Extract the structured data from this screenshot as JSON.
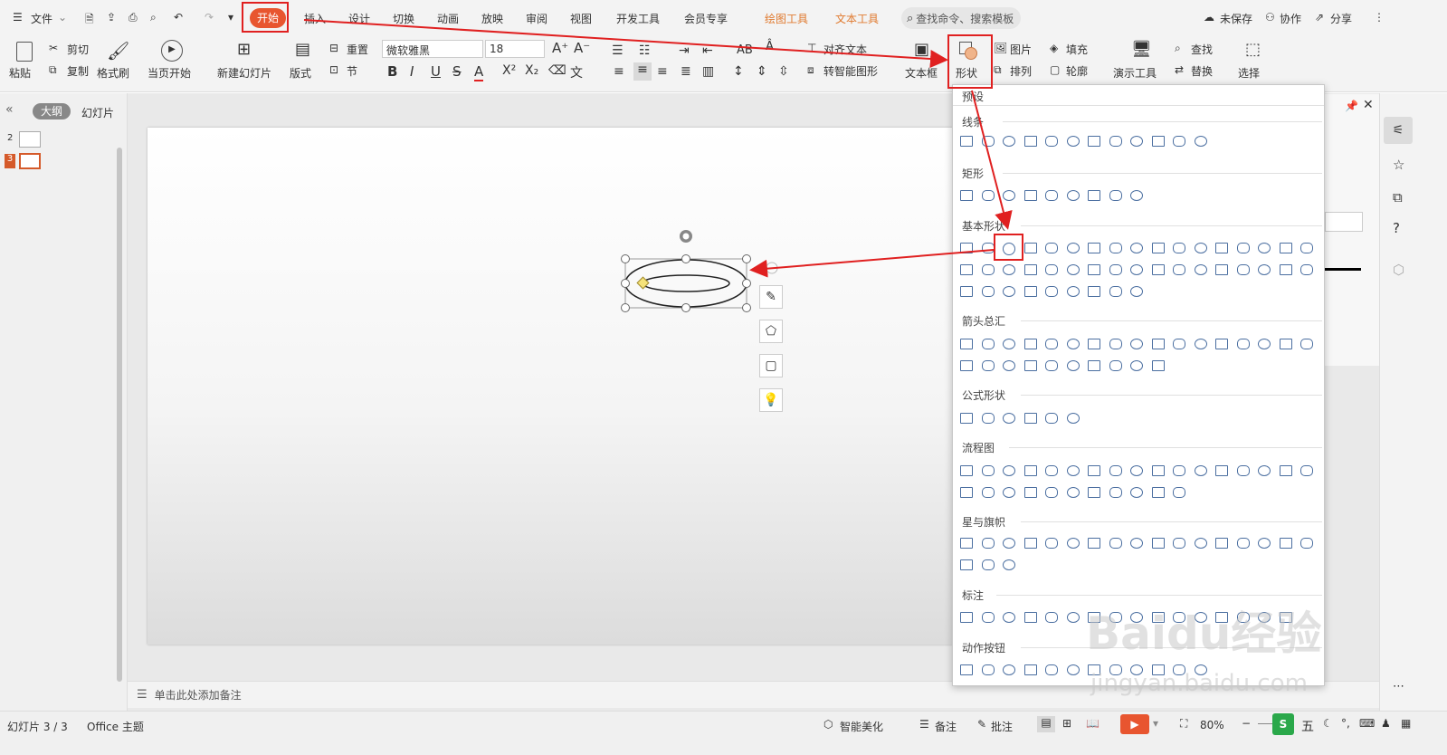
{
  "menubar": {
    "file": "文件",
    "tabs": [
      "开始",
      "插入",
      "设计",
      "切换",
      "动画",
      "放映",
      "审阅",
      "视图",
      "开发工具",
      "会员专享"
    ],
    "context_tabs": [
      "绘图工具",
      "文本工具"
    ],
    "search_placeholder": "查找命令、搜索模板",
    "unsaved": "未保存",
    "collab": "协作",
    "share": "分享"
  },
  "ribbon": {
    "paste": "粘贴",
    "cut": "剪切",
    "copy": "复制",
    "format_painter": "格式刷",
    "from_current": "当页开始",
    "new_slide": "新建幻灯片",
    "layout": "版式",
    "reset": "重置",
    "section": "节",
    "font_name": "微软雅黑",
    "font_size": "18",
    "align_text": "对齐文本",
    "smartart": "转智能图形",
    "textbox": "文本框",
    "shapes": "形状",
    "picture": "图片",
    "arrange": "排列",
    "fill": "填充",
    "outline": "轮廓",
    "presenter": "演示工具",
    "find": "查找",
    "replace": "替换",
    "select": "选择"
  },
  "left_panel": {
    "outline_tab": "大纲",
    "slides_tab": "幻灯片",
    "slide_numbers": [
      "2",
      "3"
    ]
  },
  "notes_placeholder": "单击此处添加备注",
  "shapes_dropdown": {
    "preset": "预设",
    "sections": [
      "线条",
      "矩形",
      "基本形状",
      "箭头总汇",
      "公式形状",
      "流程图",
      "星与旗帜",
      "标注",
      "动作按钮"
    ]
  },
  "statusbar": {
    "slide_info": "幻灯片 3 / 3",
    "theme": "Office 主题",
    "beautify": "智能美化",
    "notes": "备注",
    "comments": "批注",
    "zoom": "80%"
  },
  "watermark": {
    "line1": "Baidu经验",
    "line2": "jingyan.baidu.com"
  },
  "colors": {
    "accent": "#e8552f",
    "annotation": "#e02020",
    "context_tab": "#e07a2f"
  }
}
